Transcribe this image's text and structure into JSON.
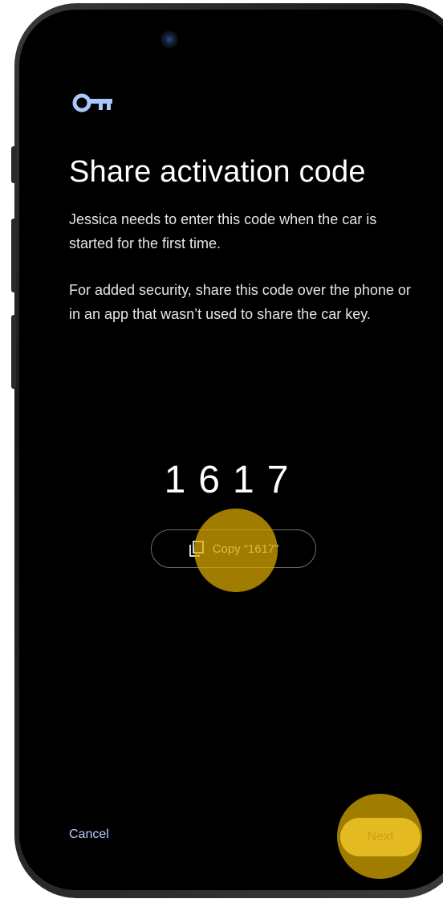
{
  "screen": {
    "title": "Share activation code",
    "paragraph_1": "Jessica needs to enter this code when the car is started for the first time.",
    "paragraph_2": "For added security, share this code over the phone or in an app that wasn’t used to share the car key.",
    "code": "1617",
    "copy_button_label": "Copy “1617”"
  },
  "footer": {
    "cancel_label": "Cancel",
    "next_label": "Next"
  },
  "icons": {
    "header": "key-icon",
    "copy": "copy-icon"
  },
  "colors": {
    "background": "#000000",
    "key_icon": "#a8c7fa",
    "cancel_text": "#b9c8ff",
    "next_button": "#f3df7a",
    "tap_highlight": "#deac00"
  }
}
